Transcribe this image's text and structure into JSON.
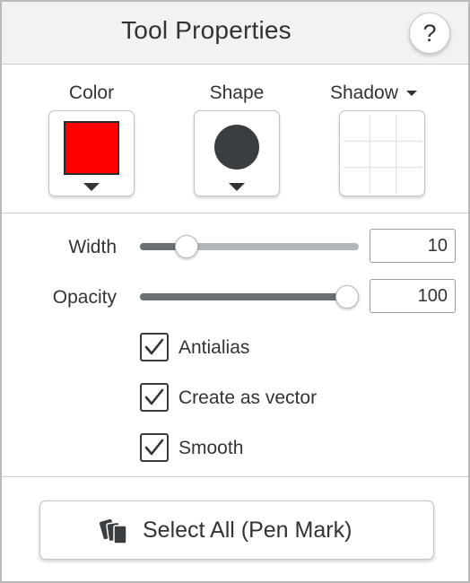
{
  "header": {
    "title": "Tool Properties",
    "help_label": "?"
  },
  "swatches": {
    "color": {
      "label": "Color",
      "value": "#ff0000",
      "icon": "chevron-down-icon"
    },
    "shape": {
      "label": "Shape",
      "value": "circle",
      "icon": "chevron-down-icon"
    },
    "shadow": {
      "label": "Shadow",
      "value": "none",
      "icon": "chevron-down-icon"
    }
  },
  "sliders": {
    "width": {
      "label": "Width",
      "value": "10",
      "fraction": 0.18
    },
    "opacity": {
      "label": "Opacity",
      "value": "100",
      "fraction": 1.0
    }
  },
  "options": [
    {
      "label": "Antialias",
      "checked": true
    },
    {
      "label": "Create as vector",
      "checked": true
    },
    {
      "label": "Smooth",
      "checked": true
    }
  ],
  "footer": {
    "select_all_label": "Select All (Pen Mark)",
    "icon": "layers-icon"
  },
  "colors": {
    "slider_fill": "#6a7073",
    "slider_track": "#b4b8ba",
    "header_bg": "#f2f2f2",
    "text": "#333333"
  }
}
